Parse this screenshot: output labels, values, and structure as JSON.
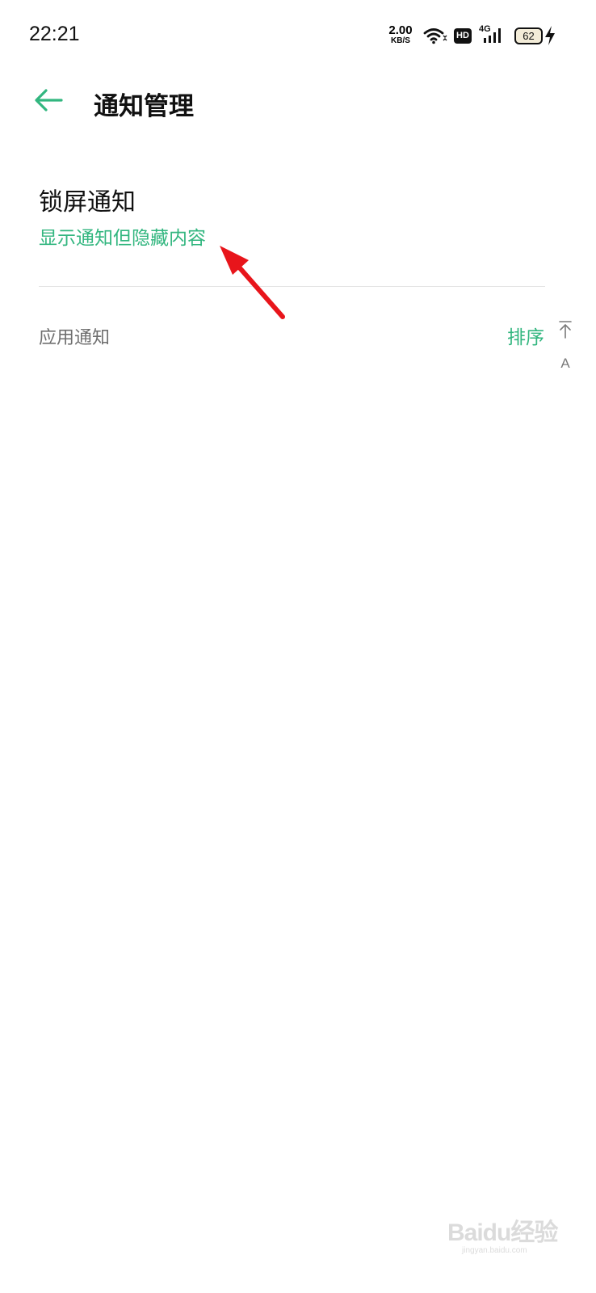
{
  "status_bar": {
    "time": "22:21",
    "net_speed_value": "2.00",
    "net_speed_unit": "KB/S",
    "hd_label": "HD",
    "network_label": "4G",
    "battery_level": "62",
    "icons": [
      "wifi-icon",
      "hd-icon",
      "signal-4g-icon",
      "battery-icon",
      "charging-icon"
    ]
  },
  "header": {
    "title": "通知管理",
    "back_icon": "arrow-left-icon"
  },
  "lock_screen": {
    "title": "锁屏通知",
    "value": "显示通知但隐藏内容"
  },
  "app_notifications": {
    "label": "应用通知",
    "sort_label": "排序"
  },
  "index_bar": {
    "top_icon": "to-top-icon",
    "letter": "A"
  },
  "watermark": {
    "main": "Baidu经验",
    "sub": "jingyan.baidu.com"
  },
  "colors": {
    "accent": "#32b67f",
    "annotation": "#e8151b",
    "text_primary": "#111111",
    "text_secondary": "#6f6f6f",
    "divider": "#e4e4e4"
  }
}
